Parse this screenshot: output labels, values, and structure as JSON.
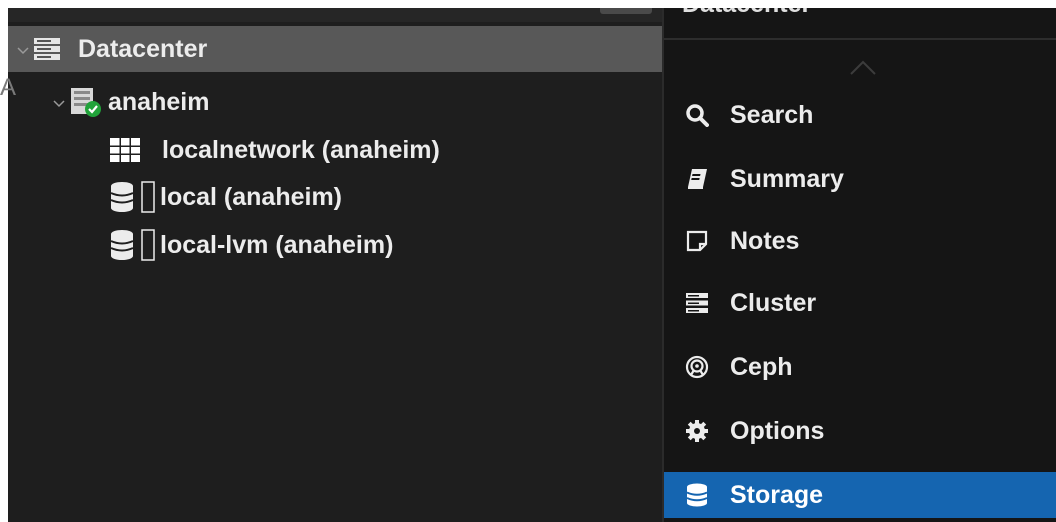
{
  "tree": {
    "items": [
      {
        "label": "Datacenter",
        "icon": "server-rack-icon",
        "expanded": true,
        "selected": true
      },
      {
        "label": "anaheim",
        "icon": "node-online-icon",
        "expanded": true,
        "status": "online"
      },
      {
        "label": "localnetwork (anaheim)",
        "icon": "network-grid-icon"
      },
      {
        "label": "local (anaheim)",
        "icon": "storage-database-icon"
      },
      {
        "label": "local-lvm (anaheim)",
        "icon": "storage-database-icon"
      }
    ],
    "clipped_char": "A"
  },
  "nav": {
    "header": "Datacenter",
    "items": [
      {
        "label": "Search",
        "icon": "search-icon"
      },
      {
        "label": "Summary",
        "icon": "book-icon"
      },
      {
        "label": "Notes",
        "icon": "note-icon"
      },
      {
        "label": "Cluster",
        "icon": "server-rack-icon"
      },
      {
        "label": "Ceph",
        "icon": "ceph-icon"
      },
      {
        "label": "Options",
        "icon": "gear-icon"
      },
      {
        "label": "Storage",
        "icon": "database-icon",
        "active": true
      }
    ]
  },
  "colors": {
    "background": "#1e1e1e",
    "selected_row": "#585858",
    "active_nav": "#1565b0",
    "status_online": "#21a33a",
    "text": "#ececec"
  }
}
